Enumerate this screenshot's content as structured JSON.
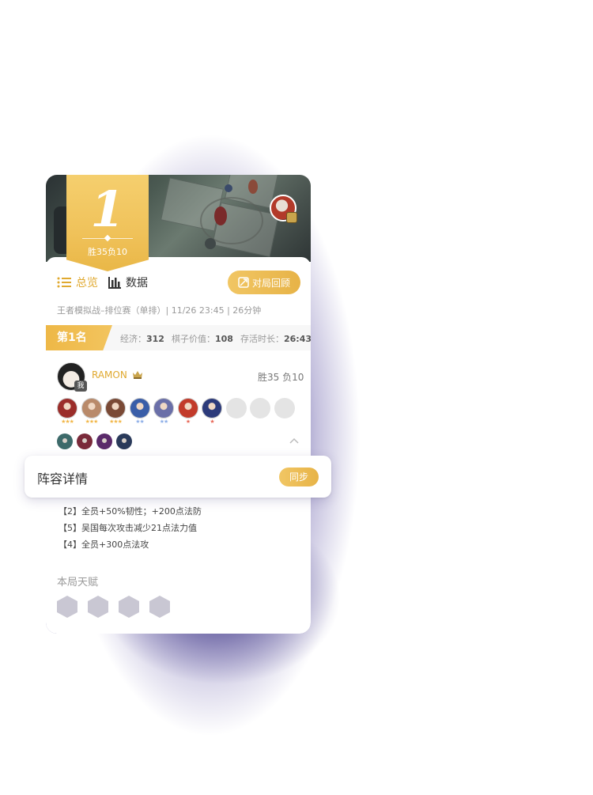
{
  "header": {
    "rank_number": "1",
    "record_short": "胜35负10"
  },
  "tabs": [
    {
      "label": "总览",
      "icon": "list-icon",
      "active": true
    },
    {
      "label": "数据",
      "icon": "bar-chart-icon",
      "active": false
    }
  ],
  "replay_button": {
    "label": "对局回顾",
    "icon": "replay-icon"
  },
  "match_info": "王者模拟战–排位赛（单排）| 11/26 23:45  | 26分钟",
  "rank_bar": {
    "rank_label": "第1名",
    "stats": [
      {
        "label": "经济：",
        "value": "312"
      },
      {
        "label": "棋子价值：",
        "value": "108"
      },
      {
        "label": "存活时长：",
        "value": "26:43"
      }
    ]
  },
  "player": {
    "name": "RAMON",
    "me_label": "我",
    "record": "胜35  负10"
  },
  "units": [
    {
      "stars": "★★★",
      "star_color": "#f2b84b",
      "color": "#9b2d2a"
    },
    {
      "stars": "★★★",
      "star_color": "#f2b84b",
      "color": "#b98a6a"
    },
    {
      "stars": "★★★",
      "star_color": "#f2b84b",
      "color": "#7a4a36"
    },
    {
      "stars": "★★",
      "star_color": "#8fb0e8",
      "color": "#3a5ea8"
    },
    {
      "stars": "★★",
      "star_color": "#8fb0e8",
      "color": "#6a6fa8"
    },
    {
      "stars": "★",
      "star_color": "#e86a5a",
      "color": "#c23a2a"
    },
    {
      "stars": "★",
      "star_color": "#e86a5a",
      "color": "#2c3a7a"
    }
  ],
  "empty_slots": 3,
  "equipment": [
    {
      "color": "#3d6a6a"
    },
    {
      "color": "#7a2a3a"
    },
    {
      "color": "#5a2a6a"
    },
    {
      "color": "#2a3a5a"
    }
  ],
  "lineup_panel": {
    "title": "阵容详情",
    "sync_label": "同步"
  },
  "bonds": [
    "【2】全员+50%韧性；+200点法防",
    "【5】吴国每次攻击减少21点法力值",
    "【4】全员+300点法攻"
  ],
  "talents": {
    "title": "本局天赋",
    "items": [
      {
        "icon": "talent-icon"
      },
      {
        "icon": "talent-icon"
      },
      {
        "icon": "talent-icon"
      },
      {
        "icon": "talent-icon"
      }
    ]
  },
  "colors": {
    "accent_gold": "#e9b747",
    "background_glow": "#463e8c"
  }
}
